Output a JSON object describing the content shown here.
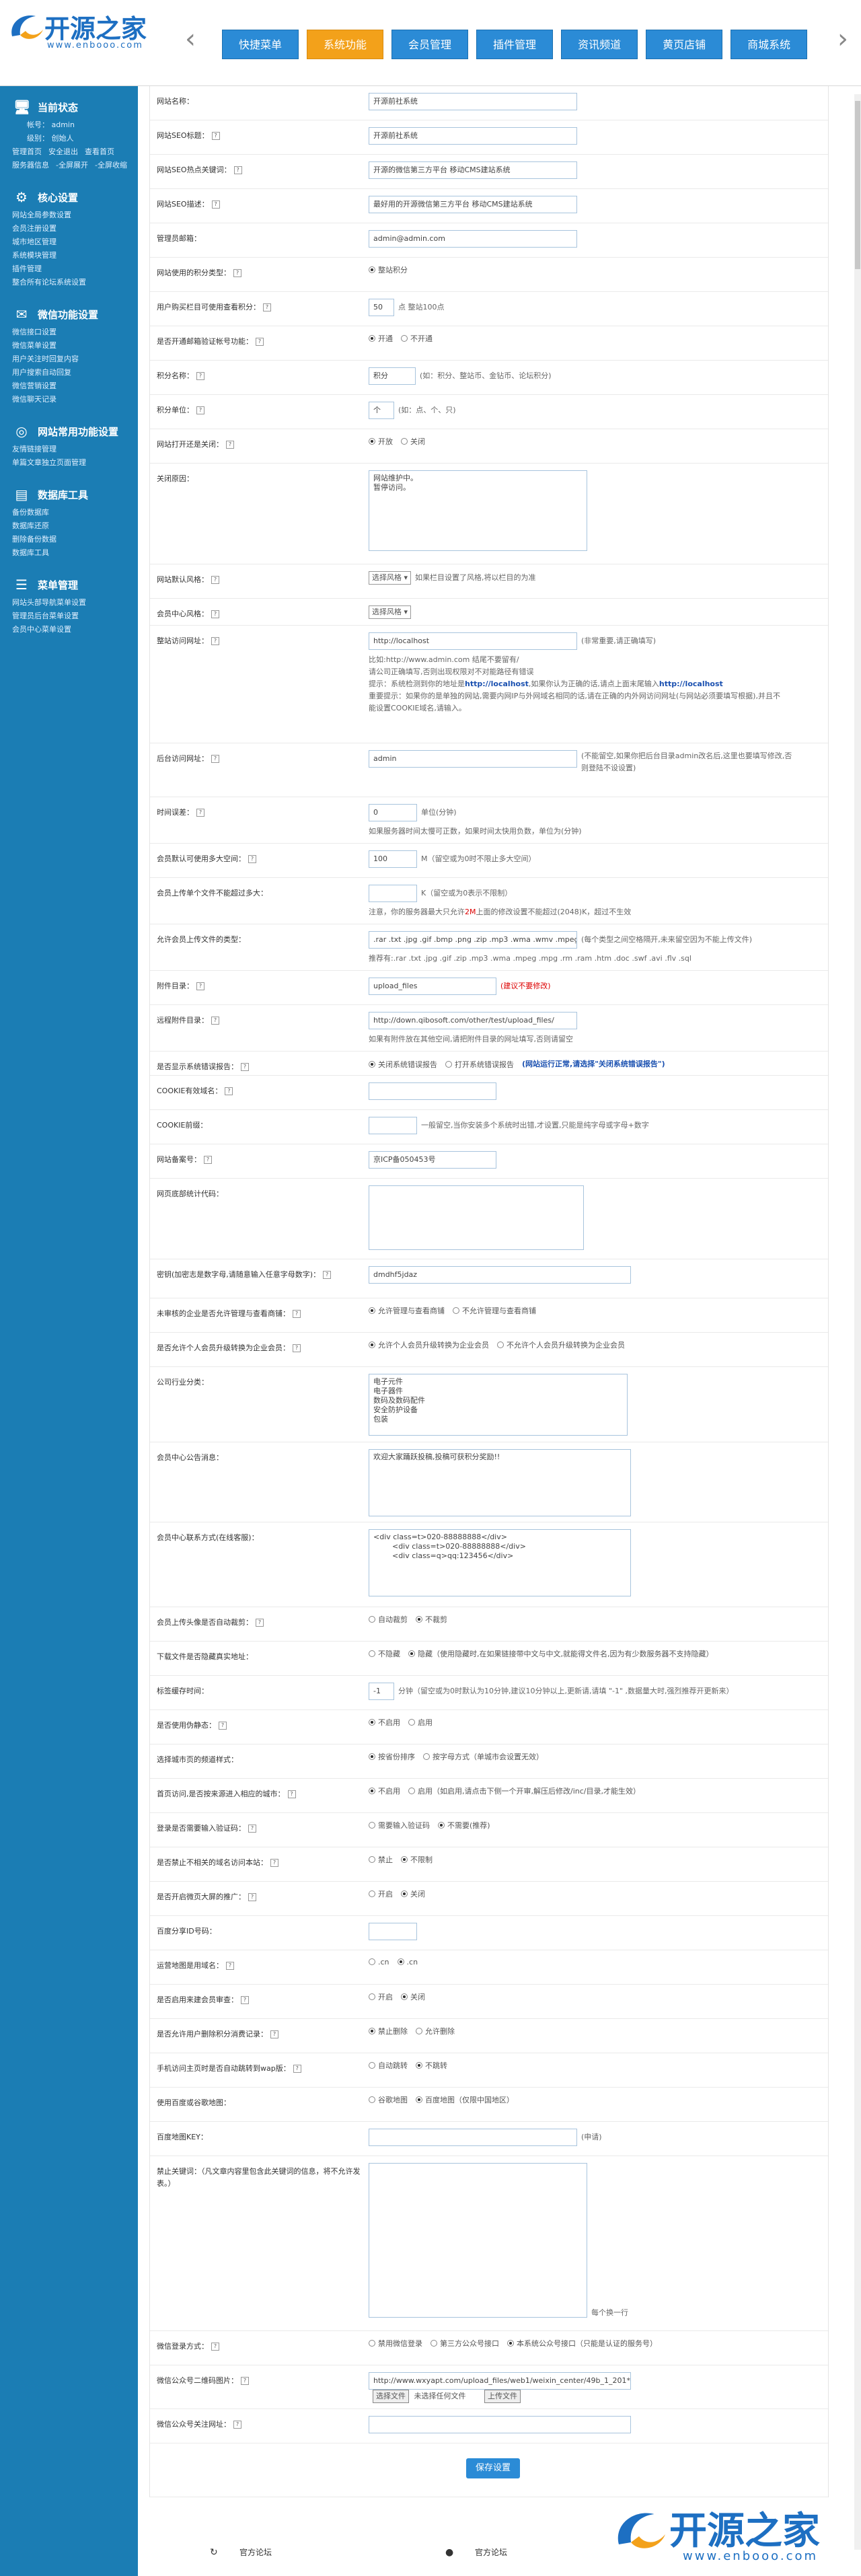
{
  "logo": {
    "text": "开源之家",
    "url": "www.enbooo.com"
  },
  "nav": {
    "prev_arrow": "‹",
    "next_arrow": "›",
    "tabs": [
      "快捷菜单",
      "系统功能",
      "会员管理",
      "插件管理",
      "资讯频道",
      "黄页店铺",
      "商城系统"
    ],
    "active_index": 1
  },
  "sidebar": {
    "status": {
      "title": "当前状态",
      "lines": [
        "帐号： admin",
        "级别： 创始人"
      ],
      "links": [
        "管理首页",
        "安全退出",
        "查看首页",
        "服务器信息",
        "-全屏展开",
        "-全屏收缩"
      ]
    },
    "groups": [
      {
        "title": "核心设置",
        "links": [
          "网站全局参数设置",
          "会员注册设置",
          "城市地区管理",
          "系统模块管理",
          "插件管理",
          "整合所有论坛系统设置"
        ]
      },
      {
        "title": "微信功能设置",
        "links": [
          "微信接口设置",
          "微信菜单设置",
          "用户关注时回复内容",
          "用户搜索自动回复",
          "微信营销设置",
          "微信聊天记录"
        ]
      },
      {
        "title": "网站常用功能设置",
        "links": [
          "友情链接管理",
          "单篇文章独立页面管理"
        ]
      },
      {
        "title": "数据库工具",
        "links": [
          "备份数据库",
          "数据库还原",
          "删除备份数据",
          "数据库工具"
        ]
      },
      {
        "title": "菜单管理",
        "links": [
          "网站头部导航菜单设置",
          "管理员后台菜单设置",
          "会员中心菜单设置"
        ]
      }
    ]
  },
  "form": {
    "site_name": {
      "label": "网站名称：",
      "value": "开源前社系统"
    },
    "seo_title": {
      "label": "网站SEO标题：",
      "value": "开源前社系统"
    },
    "seo_keywords": {
      "label": "网站SEO热点关键词：",
      "value": "开源的微信第三方平台 移动CMS建站系统"
    },
    "seo_desc": {
      "label": "网站SEO描述：",
      "value": "最好用的开源微信第三方平台 移动CMS建站系统"
    },
    "admin_email": {
      "label": "管理员邮箱：",
      "value": "admin@admin.com"
    },
    "points_type": {
      "label": "网站使用的积分类型：",
      "option": "整站积分"
    },
    "buy_points": {
      "label": "用户购买栏目可使用查看积分：",
      "value": "50",
      "hint": "点 整站100点"
    },
    "email_verify": {
      "label": "是否开通邮箱验证帐号功能：",
      "options": [
        "开通",
        "不开通"
      ],
      "selected": 0
    },
    "points_name": {
      "label": "积分名称：",
      "value": "积分",
      "hint": "(如：积分、整站币、金钻币、论坛积分)"
    },
    "points_unit": {
      "label": "积分单位：",
      "value": "个",
      "hint": "(如：点、个、只)"
    },
    "site_open": {
      "label": "网站打开还是关闭：",
      "options": [
        "开放",
        "关闭"
      ],
      "selected": 0
    },
    "close_reason": {
      "label": "关闭原因：",
      "value": "网站维护中。\n暂停访问。"
    },
    "default_style": {
      "label": "网站默认风格：",
      "select": "选择风格 ▾",
      "hint": "如果栏目设置了风格,将以栏目的为准"
    },
    "member_style": {
      "label": "会员中心风格：",
      "select": "选择风格 ▾"
    },
    "site_url": {
      "label": "整站访问网址：",
      "value": "http://localhost",
      "hint": "(非常重要,请正确填写)",
      "note1": "比如:http://www.admin.com 结尾不要留有/",
      "note2": "请公司正确填写,否则出现权限对不对能路径有错误",
      "note3": "提示：系统检测到你的地址是",
      "note3_link": "http://localhost",
      "note3b": ",如果你认为正确的话,请点上面末尾输入",
      "note3_link2": "http://localhost",
      "note4": "重要提示：如果你的是单独的网站,需要内网IP与外网域名相同的话,请在正确的内外网访问网址(与网站必须要填写根据),并且不能设置COOKIE域名,请输入。"
    },
    "admin_url": {
      "label": "后台访问网址：",
      "value": "admin",
      "hint": "(不能留空,如果你把后台目录admin改名后,这里也要填写修改,否则登陆不设设置)"
    },
    "time_diff": {
      "label": "时间误差：",
      "value": "0",
      "hint": "单位(分钟)",
      "note": "如果服务器时间太慢可正数，如果时间太快用负数，单位为(分钟)"
    },
    "upload_size": {
      "label": "会员默认可使用多大空间：",
      "value": "100",
      "hint": "M（留空或为0时不限止多大空间）"
    },
    "upload_file_size": {
      "label": "会员上传单个文件不能超过多大：",
      "value": "",
      "hint": "K（留空或为0表示不限制）",
      "note": "注意，你的服务器最大只允许",
      "note_red": "2M",
      "note_b": "上面的修改设置不能超过(2048)K，超过不生效"
    },
    "allow_types": {
      "label": "允许会员上传文件的类型：",
      "value": ".rar .txt .jpg .gif .bmp .png .zip .mp3 .wma .wmv .mpeg",
      "hint": "(每个类型之间空格隔开,未来留空因为不能上传文件)",
      "note": "推荐有:.rar .txt .jpg .gif .zip .mp3 .wma .mpeg .mpg .rm .ram .htm .doc .swf .avi .flv .sql"
    },
    "upload_dir": {
      "label": "附件目录：",
      "value": "upload_files",
      "hint": "(建议不要修改)"
    },
    "remote_dir": {
      "label": "远程附件目录：",
      "value": "http://down.qibosoft.com/other/test/upload_files/",
      "note": "如果有附件放在其他空间,请把附件目录的网址填写,否则请留空"
    },
    "error_report": {
      "label": "是否显示系统错误报告：",
      "options": [
        "关闭系统错误报告",
        "打开系统错误报告"
      ],
      "selected": 0,
      "hint": "(网站运行正常,请选择\"关闭系统错误报告\")"
    },
    "cookie_domain": {
      "label": "COOKIE有效域名：",
      "value": ""
    },
    "cookie_prefix": {
      "label": "COOKIE前缀：",
      "value": "",
      "hint": "一般留空,当你安装多个系统时出错,才设置,只能是纯字母或字母+数字"
    },
    "icp": {
      "label": "网站备案号：",
      "value": "京ICP备050453号"
    },
    "stat_code": {
      "label": "网页底部统计代码：",
      "value": ""
    },
    "secret_key": {
      "label": "密钥(加密志是数字母,请随意输入任意字母数字)：",
      "value": "dmdhf5jdaz"
    },
    "no_audit": {
      "label": "未审核的企业是否允许管理与查看商铺：",
      "options": [
        "允许管理与查看商铺",
        "不允许管理与查看商铺"
      ],
      "selected": 0
    },
    "personal_upgrade": {
      "label": "是否允许个人会员升级转换为企业会员：",
      "options": [
        "允许个人会员升级转换为企业会员",
        "不允许个人会员升级转换为企业会员"
      ],
      "selected": 0
    },
    "industry": {
      "label": "公司行业分类：",
      "value": "电子元件\n电子器件\n数码及数码配件\n安全防护设备\n包装"
    },
    "member_notice": {
      "label": "会员中心公告消息：",
      "value": "欢迎大家踊跃投稿,投稿可获积分奖励!!"
    },
    "contact": {
      "label": "会员中心联系方式(在线客服)：",
      "value": "<div class=t>020-88888888</div>\n        <div class=t>020-88888888</div>\n        <div class=q>qq:123456</div>"
    },
    "upload_watermark": {
      "label": "会员上传头像是否自动裁剪：",
      "options": [
        "自动裁剪",
        "不裁剪"
      ],
      "selected": 1
    },
    "download_mode": {
      "label": "下载文件是否隐藏真实地址：",
      "options": [
        "不隐藏",
        "隐藏（使用隐藏时,在如果链接带中文与中文,就能得文件名,因为有少数服务器不支持隐藏）"
      ],
      "selected": 1
    },
    "mark_seconds": {
      "label": "标签缓存时间：",
      "value": "-1",
      "hint": "分钟（留空或为0时默认为10分钟,建议10分钟以上,更新请,请填 \"-1\" ,数据量大时,强烈推荐开更新来）"
    },
    "static": {
      "label": "是否使用伪静态：",
      "options": [
        "不启用",
        "启用"
      ],
      "selected": 0
    },
    "city_style": {
      "label": "选择城市页的频道样式：",
      "options": [
        "按省份排序",
        "按字母方式（单城市会设置无效）"
      ],
      "selected": 0
    },
    "auto_city": {
      "label": "首页访问,是否按来源进入相应的城市：",
      "options": [
        "不启用",
        "启用（如启用,请点击下侧一个开审,解压后修改/inc/目录,才能生效）"
      ],
      "selected": 0
    },
    "login_verify": {
      "label": "登录是否需要输入验证码：",
      "options": [
        "需要输入验证码",
        "不需要(推荐)"
      ],
      "selected": 1
    },
    "ban_copy": {
      "label": "是否禁止不相关的域名访问本站：",
      "options": [
        "禁止",
        "不限制"
      ],
      "selected": 1
    },
    "share": {
      "label": "是否开启微页大屏的推广：",
      "options": [
        "开启",
        "关闭"
      ],
      "selected": 1
    },
    "baidu_id": {
      "label": "百度分享ID号码：",
      "value": ""
    },
    "search_domain": {
      "label": "运营地图是用域名：",
      "options": [
        ".cn",
        ".cn"
      ],
      "selected": 1
    },
    "app_verify": {
      "label": "是否启用来建会员审查：",
      "options": [
        "开启",
        "关闭"
      ],
      "selected": 1
    },
    "delete_confirm": {
      "label": "是否允许用户删除积分消费记录：",
      "options": [
        "禁止删除",
        "允许删除"
      ],
      "selected": 0
    },
    "mobile_jump": {
      "label": "手机访问主页时是否自动跳转到wap版：",
      "options": [
        "自动跳转",
        "不跳转"
      ],
      "selected": 1
    },
    "map_type": {
      "label": "使用百度或谷歌地图：",
      "options": [
        "谷歌地图",
        "百度地图（仅限中国地区）"
      ],
      "selected": 1
    },
    "baidu_key": {
      "label": "百度地图KEY：",
      "value": "",
      "hint": "(申请)"
    },
    "ban_words": {
      "label": "禁止关键词：（凡文章内容里包含此关键词的信息，将不允许发表。）",
      "value": "",
      "hint": "每个换一行"
    },
    "wx_login": {
      "label": "微信登录方式：",
      "options": [
        "禁用微信登录",
        "第三方公众号接口",
        "本系统公众号接口（只能是认证的服务号）"
      ],
      "selected": 2
    },
    "wx_qrcode": {
      "label": "微信公众号二维码图片：",
      "value": "http://www.wxyapt.com/upload_files/web1/weixin_center/49b_1_201*",
      "btn1": "选择文件",
      "file_status": "未选择任何文件",
      "btn2": "上传文件"
    },
    "wx_follow": {
      "label": "微信公众号关注网址：",
      "value": ""
    }
  },
  "save_button": "保存设置",
  "footer": {
    "left_link": "官方论坛",
    "right_link": "官方论坛"
  },
  "watermark": {
    "text": "开源之家",
    "url": "www.enbooo.com"
  }
}
